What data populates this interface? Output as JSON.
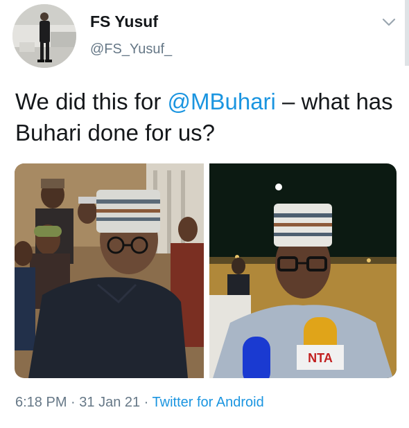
{
  "author": {
    "name": "FS Yusuf",
    "handle": "@FS_Yusuf_"
  },
  "tweet": {
    "text_before": "We did this for ",
    "mention": "@MBuhari",
    "text_after": " – what has Buhari done for us?"
  },
  "media": {
    "right_mic_logo": "NTA"
  },
  "meta": {
    "time": "6:18 PM",
    "sep1": " · ",
    "date": "31 Jan 21",
    "sep2": " · ",
    "source": "Twitter for Android"
  },
  "icons": {
    "menu": "chevron-down-icon"
  },
  "colors": {
    "link": "#1b95e0",
    "secondary_text": "#657786",
    "primary_text": "#14171a"
  }
}
